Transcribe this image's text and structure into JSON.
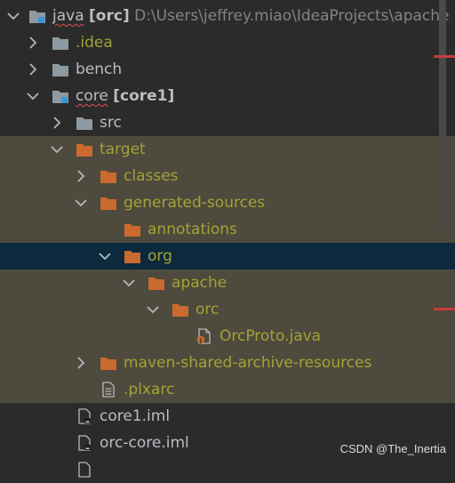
{
  "tree": {
    "root": {
      "name": "java",
      "module": "[orc]",
      "path": "D:\\Users\\jeffrey.miao\\IdeaProjects\\apache"
    },
    "idea": {
      "name": ".idea"
    },
    "bench": {
      "name": "bench"
    },
    "core": {
      "name": "core",
      "module": "[core1]"
    },
    "src": {
      "name": "src"
    },
    "target": {
      "name": "target"
    },
    "classes": {
      "name": "classes"
    },
    "generated_sources": {
      "name": "generated-sources"
    },
    "annotations": {
      "name": "annotations"
    },
    "org": {
      "name": "org"
    },
    "apache": {
      "name": "apache"
    },
    "orc": {
      "name": "orc"
    },
    "orcproto": {
      "name": "OrcProto.java"
    },
    "maven_shared": {
      "name": "maven-shared-archive-resources"
    },
    "plxarc": {
      "name": ".plxarc"
    },
    "core1_iml": {
      "name": "core1.iml"
    },
    "orc_core_iml": {
      "name": "orc-core.iml"
    }
  },
  "watermark": "CSDN @The_Inertia",
  "colors": {
    "background": "#2b2b2b",
    "ignored_row": "#4e4a3d",
    "selected_row": "#0d293e",
    "folder_orange": "#c96a2e",
    "folder_gray": "#8e9aa2",
    "ignored_text": "#a3a335",
    "default_text": "#b9bec4",
    "error_mark": "#c93b3b"
  }
}
